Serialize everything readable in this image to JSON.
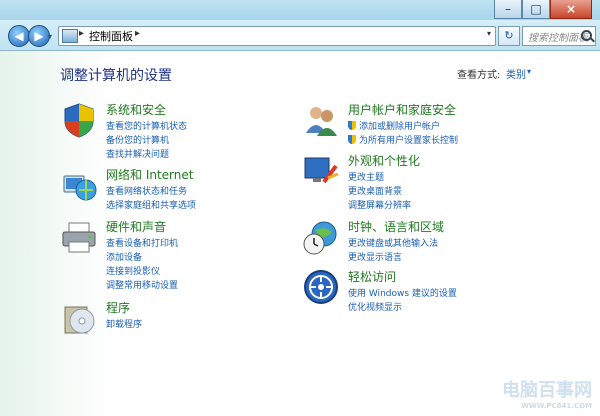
{
  "window": {
    "caption": {
      "minimize": "–",
      "maximize": "□",
      "close": "×"
    }
  },
  "nav": {
    "back": "◀",
    "forward": "▶",
    "dropdown": "▾",
    "breadcrumb": "控制面板",
    "refresh": "↻",
    "search_placeholder": "搜索控制面板"
  },
  "header": {
    "title": "调整计算机的设置",
    "view_by_label": "查看方式:",
    "view_by_value": "类别",
    "view_by_arrow": "▾"
  },
  "categories": [
    {
      "name": "系统和安全",
      "icon": "shield-flag-icon",
      "links": [
        "查看您的计算机状态",
        "备份您的计算机",
        "查找并解决问题"
      ]
    },
    {
      "name": "网络和 Internet",
      "icon": "network-globe-icon",
      "links": [
        "查看网络状态和任务",
        "选择家庭组和共享选项"
      ]
    },
    {
      "name": "硬件和声音",
      "icon": "printer-icon",
      "links": [
        "查看设备和打印机",
        "添加设备",
        "连接到投影仪",
        "调整常用移动设置"
      ]
    },
    {
      "name": "程序",
      "icon": "programs-disc-icon",
      "links": [
        "卸载程序"
      ]
    },
    {
      "name": "用户帐户和家庭安全",
      "icon": "users-icon",
      "links": [
        "添加或删除用户帐户",
        "为所有用户设置家长控制"
      ],
      "shielded": [
        true,
        true
      ]
    },
    {
      "name": "外观和个性化",
      "icon": "monitor-paint-icon",
      "links": [
        "更改主题",
        "更改桌面背景",
        "调整屏幕分辨率"
      ]
    },
    {
      "name": "时钟、语言和区域",
      "icon": "clock-globe-icon",
      "links": [
        "更改键盘或其他输入法",
        "更改显示语言"
      ]
    },
    {
      "name": "轻松访问",
      "icon": "ease-of-access-icon",
      "links": [
        "使用 Windows 建议的设置",
        "优化视频显示"
      ]
    }
  ],
  "watermark": {
    "text": "电脑百事网",
    "url": "WWW.PC841.COM"
  },
  "colors": {
    "link": "#1a5fb4",
    "category_title": "#1f7a1f",
    "page_title": "#1e3287"
  }
}
